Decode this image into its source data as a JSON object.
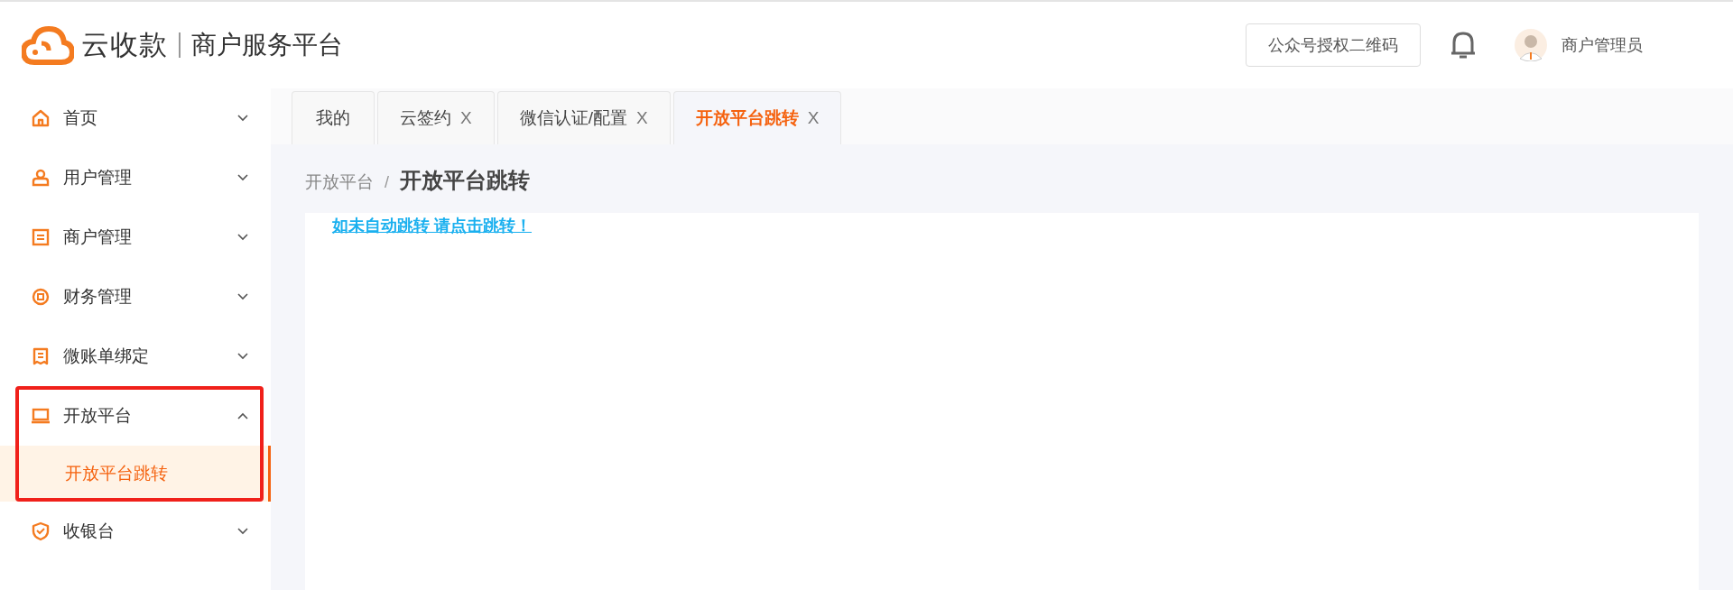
{
  "header": {
    "brand": "云收款",
    "subtitle": "商户服务平台",
    "qr_button": "公众号授权二维码",
    "user": "商户管理员"
  },
  "sidebar": {
    "items": [
      {
        "label": "首页",
        "expanded": false,
        "highlighted": false
      },
      {
        "label": "用户管理",
        "expanded": false,
        "highlighted": false
      },
      {
        "label": "商户管理",
        "expanded": false,
        "highlighted": false
      },
      {
        "label": "财务管理",
        "expanded": false,
        "highlighted": false
      },
      {
        "label": "微账单绑定",
        "expanded": false,
        "highlighted": false
      },
      {
        "label": "开放平台",
        "expanded": true,
        "highlighted": true,
        "children": [
          {
            "label": "开放平台跳转",
            "selected": true
          }
        ]
      },
      {
        "label": "收银台",
        "expanded": false,
        "highlighted": false
      }
    ]
  },
  "tabs": [
    {
      "label": "我的",
      "selected": false
    },
    {
      "label": "云签约",
      "close": "X",
      "selected": false
    },
    {
      "label": "微信认证/配置",
      "close": "X",
      "selected": false
    },
    {
      "label": "开放平台跳转",
      "close": "X",
      "selected": true
    }
  ],
  "breadcrumb": {
    "parent": "开放平台",
    "separator": "/",
    "current": "开放平台跳转"
  },
  "content": {
    "link": "如未自动跳转 请点击跳转！"
  }
}
